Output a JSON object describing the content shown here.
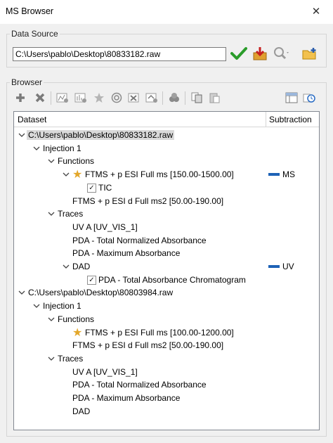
{
  "window": {
    "title": "MS Browser",
    "close_glyph": "✕"
  },
  "data_source": {
    "legend": "Data Source",
    "path_value": "C:\\Users\\pablo\\Desktop\\80833182.raw",
    "icons": [
      "check-icon",
      "download-icon",
      "search-icon",
      "add-folder-icon"
    ]
  },
  "browser": {
    "legend": "Browser",
    "toolbar_icons": [
      "add-icon",
      "remove-icon",
      "chromatogram-add-icon",
      "spectrum-add-icon",
      "star-icon",
      "target-icon",
      "delete-trace-icon",
      "replace-icon",
      "flask-icon",
      "copy-icon",
      "paste-icon",
      "columns-icon",
      "history-icon"
    ],
    "columns": {
      "dataset": "Dataset",
      "subtraction": "Subtraction"
    },
    "colors": {
      "subtraction_marker": "#1e62b6",
      "star": "#e3a72a",
      "check": "#2a9c2a",
      "selection": "#d9d9d9"
    },
    "rows": [
      {
        "text": "C:\\Users\\pablo\\Desktop\\80833182.raw",
        "level": 0,
        "chevron": "down",
        "selected": true
      },
      {
        "text": "Injection 1",
        "level": 1,
        "chevron": "down"
      },
      {
        "text": "Functions",
        "level": 2,
        "chevron": "down"
      },
      {
        "text": "FTMS + p ESI Full ms [150.00-1500.00]",
        "level": 3,
        "chevron": "down",
        "star": true,
        "subtraction": "MS"
      },
      {
        "text": "TIC",
        "level": 4,
        "checkbox": true,
        "checked": true
      },
      {
        "text": "FTMS + p ESI d Full ms2 [50.00-190.00]",
        "level": 3
      },
      {
        "text": "Traces",
        "level": 2,
        "chevron": "down"
      },
      {
        "text": "UV A [UV_VIS_1]",
        "level": 3
      },
      {
        "text": "PDA - Total Normalized Absorbance",
        "level": 3
      },
      {
        "text": "PDA - Maximum Absorbance",
        "level": 3
      },
      {
        "text": "DAD",
        "level": 3,
        "chevron": "down",
        "subtraction": "UV"
      },
      {
        "text": "PDA - Total Absorbance Chromatogram",
        "level": 4,
        "checkbox": true,
        "checked": true
      },
      {
        "text": "C:\\Users\\pablo\\Desktop\\80803984.raw",
        "level": 0,
        "chevron": "down"
      },
      {
        "text": "Injection 1",
        "level": 1,
        "chevron": "down"
      },
      {
        "text": "Functions",
        "level": 2,
        "chevron": "down"
      },
      {
        "text": "FTMS + p ESI Full ms [100.00-1200.00]",
        "level": 3,
        "star": true
      },
      {
        "text": "FTMS + p ESI d Full ms2 [50.00-190.00]",
        "level": 3
      },
      {
        "text": "Traces",
        "level": 2,
        "chevron": "down"
      },
      {
        "text": "UV A [UV_VIS_1]",
        "level": 3
      },
      {
        "text": "PDA - Total Normalized Absorbance",
        "level": 3
      },
      {
        "text": "PDA - Maximum Absorbance",
        "level": 3
      },
      {
        "text": "DAD",
        "level": 3
      }
    ]
  }
}
